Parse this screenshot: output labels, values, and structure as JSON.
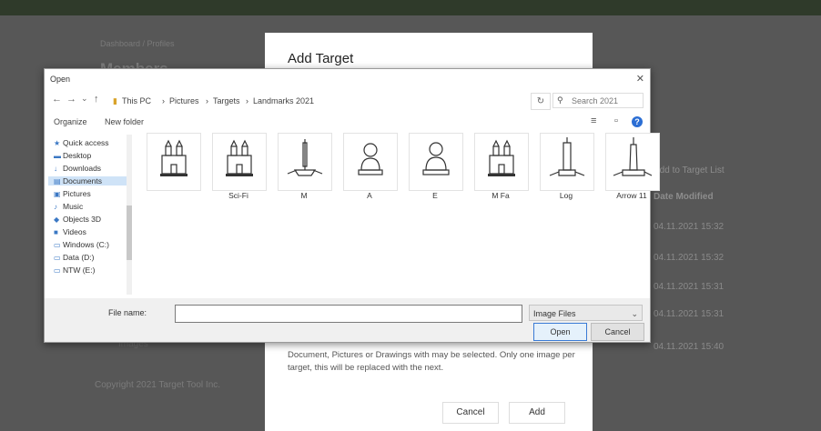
{
  "background": {
    "breadcrumb": "Dashboard / Profiles",
    "title": "Members",
    "link": "Add to Target List",
    "column_header": "Date Modified",
    "dates": [
      "04.11.2021 15:32",
      "04.11.2021 15:32",
      "04.11.2021 15:31",
      "04.11.2021 15:31",
      "04.11.2021 15:40"
    ],
    "muted_text": "Images",
    "footer": "Copyright 2021 Target Tool Inc."
  },
  "modal": {
    "title": "Add Target",
    "hint": "Document, Pictures or Drawings with may be selected. Only one image per target, this will be replaced with the next.",
    "cancel_label": "Cancel",
    "add_label": "Add"
  },
  "dialog": {
    "title": "Open",
    "path": [
      "This PC",
      "Pictures",
      "Targets",
      "Landmarks 2021"
    ],
    "search_placeholder": "Search 2021",
    "organize_label": "Organize",
    "new_folder_label": "New folder",
    "nav_items": [
      {
        "label": "Quick access",
        "icon": "star-icon",
        "selected": false
      },
      {
        "label": "Desktop",
        "icon": "desktop-icon",
        "selected": false
      },
      {
        "label": "Downloads",
        "icon": "download-icon",
        "selected": false
      },
      {
        "label": "Documents",
        "icon": "document-icon",
        "selected": true
      },
      {
        "label": "Pictures",
        "icon": "picture-icon",
        "selected": false
      },
      {
        "label": "Music",
        "icon": "music-icon",
        "selected": false
      },
      {
        "label": "Objects 3D",
        "icon": "cube-icon",
        "selected": false
      },
      {
        "label": "Videos",
        "icon": "video-icon",
        "selected": false
      },
      {
        "label": "Windows (C:)",
        "icon": "drive-icon",
        "selected": false
      },
      {
        "label": "Data (D:)",
        "icon": "drive-icon",
        "selected": false
      },
      {
        "label": "NTW (E:)",
        "icon": "network-icon",
        "selected": false
      }
    ],
    "files": [
      {
        "name": "",
        "kind": "building"
      },
      {
        "name": "Sci-Fi",
        "kind": "building"
      },
      {
        "name": "M",
        "kind": "monument"
      },
      {
        "name": "A",
        "kind": "bust"
      },
      {
        "name": "E",
        "kind": "bust2"
      },
      {
        "name": "M Fa",
        "kind": "building"
      },
      {
        "name": "Log",
        "kind": "tower"
      },
      {
        "name": "Arrow 11",
        "kind": "tower2"
      }
    ],
    "filename_label": "File name:",
    "filename_value": "",
    "filter_label": "Image Files",
    "open_label": "Open",
    "cancel_label": "Cancel"
  }
}
